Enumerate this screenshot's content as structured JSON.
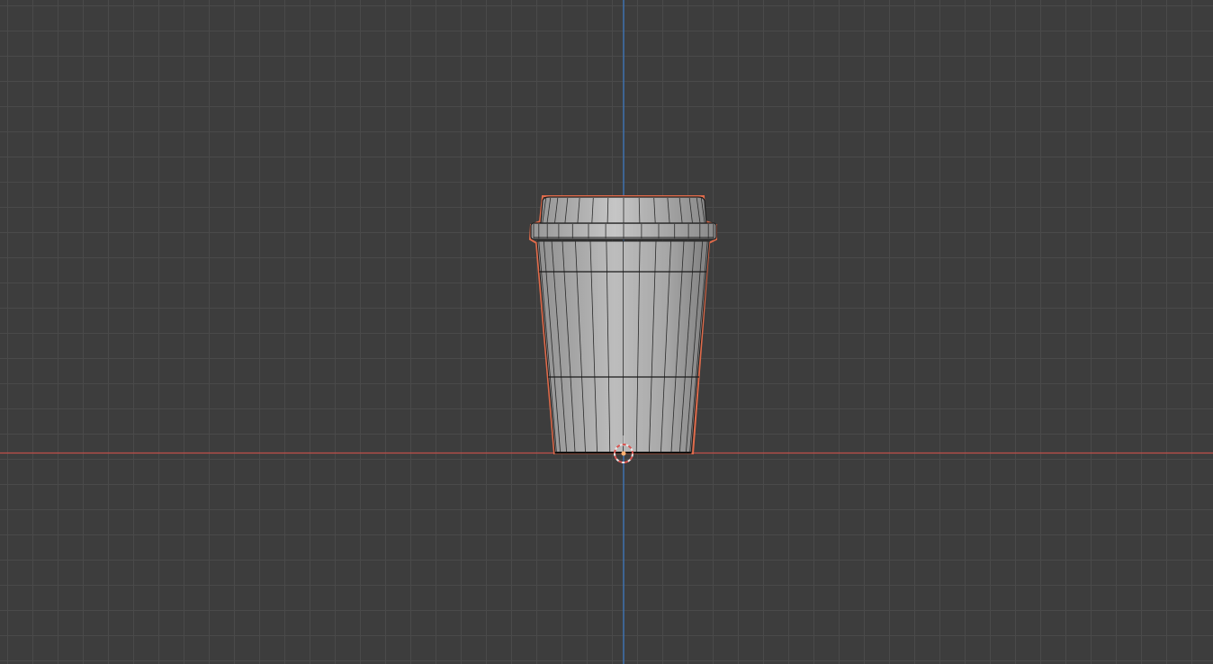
{
  "viewport": {
    "view": "front-orthographic",
    "grid_visible": true,
    "colors": {
      "background": "#3d3d3d",
      "grid_line": "#4a4a4a",
      "x_axis": "#c0504a",
      "z_axis": "#3f6fa8",
      "selection_outline": "#e06b4b",
      "mesh_fill": "#a9a9a9",
      "wire": "#1e1e1e"
    }
  },
  "scene": {
    "object": {
      "name": "coffee-cup",
      "selected": true,
      "mode": "object"
    },
    "cursor_3d": {
      "visible": true
    },
    "origin_marker": {
      "visible": true
    }
  }
}
